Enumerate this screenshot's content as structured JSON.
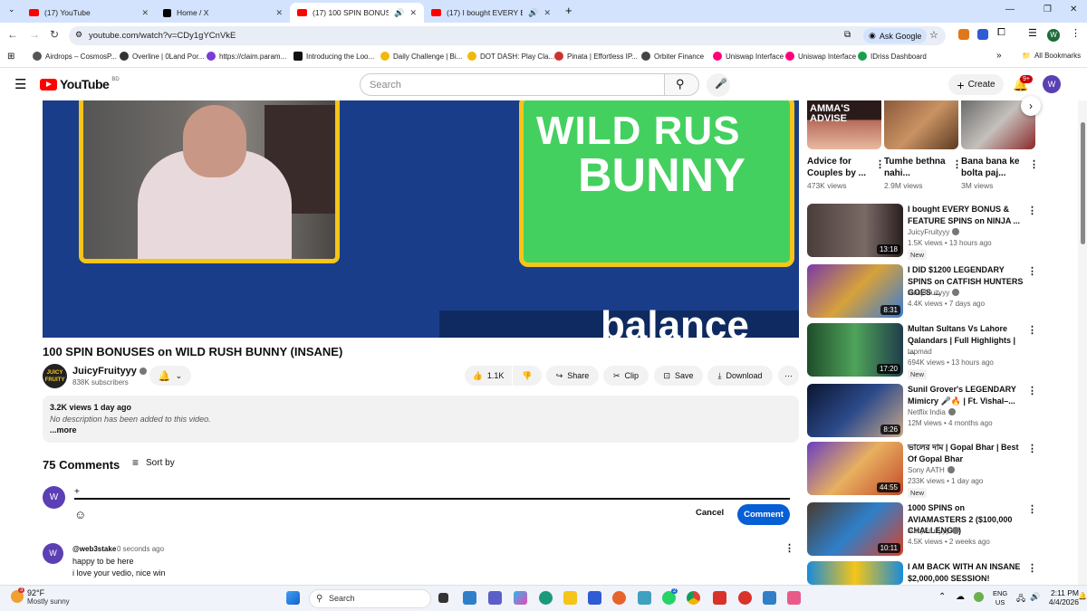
{
  "browser": {
    "tabs": [
      {
        "title": "(17) YouTube",
        "icon": "youtube-icon"
      },
      {
        "title": "Home / X",
        "icon": "x-icon"
      },
      {
        "title": "(17) 100 SPIN BONUSES on",
        "icon": "youtube-icon",
        "active": true
      },
      {
        "title": "(17) I bought EVERY BONUS",
        "icon": "youtube-icon"
      }
    ],
    "url": "youtube.com/watch?v=CDy1gYCnVkE",
    "ask_google": "Ask Google",
    "profile_initial": "W",
    "bookmarks": [
      "Airdrops – CosmosP...",
      "Overline | 0Land Por...",
      "https://claim.param...",
      "Introducing the Loo...",
      "Daily Challenge | Bi...",
      "DOT DASH: Play Cla...",
      "Pinata | Effortless IP...",
      "Orbiter Finance",
      "Uniswap Interface",
      "Uniswap Interface",
      "IDriss Dashboard"
    ],
    "all_bookmarks": "All Bookmarks"
  },
  "youtube": {
    "logo_text": "YouTube",
    "country": "BD",
    "search_placeholder": "Search",
    "create_label": "Create",
    "notif_count": "9+",
    "avatar_initial": "W"
  },
  "video": {
    "overlay_text_1": "WILD RUS",
    "overlay_text_2": "BUNNY",
    "overlay_text_3": "balance",
    "title": "100 SPIN BONUSES on WILD RUSH BUNNY (INSANE)",
    "channel": "JuicyFruityyy",
    "channel_logo_text": "JUICY FRUITY",
    "subscribers": "838K subscribers",
    "likes": "1.1K",
    "share": "Share",
    "clip": "Clip",
    "save": "Save",
    "download": "Download",
    "views_date": "3.2K views  1 day ago",
    "description": "No description has been added to this video.",
    "more": "...more"
  },
  "comments": {
    "count_label": "75 Comments",
    "sort_by": "Sort by",
    "input_value": "+",
    "cancel": "Cancel",
    "comment_btn": "Comment",
    "items": [
      {
        "user": "@web3stake",
        "time": "0 seconds ago",
        "line1": "happy to be here",
        "line2": "i love your vedio, nice win",
        "avatar": "W"
      }
    ]
  },
  "shorts": [
    {
      "title": "Advice for Couples by ...",
      "views": "473K views",
      "thumb_text": "AMMA'S ADVISE"
    },
    {
      "title": "Tumhe bethna nahi...",
      "views": "2.9M views"
    },
    {
      "title": "Bana bana ke bolta paj...",
      "views": "3M views"
    }
  ],
  "recommendations": [
    {
      "title": "I bought EVERY BONUS & FEATURE SPINS on NINJA ...",
      "channel": "JuicyFruityyy",
      "verified": true,
      "meta": "1.5K views • 13 hours ago",
      "badge": "New",
      "duration": "13:18",
      "color": "#5a4a46"
    },
    {
      "title": "I DID $1200 LEGENDARY SPINS on CATFISH HUNTERS GOES ...",
      "channel": "JuicyFruityyy",
      "verified": true,
      "meta": "4.4K views • 7 days ago",
      "badge": "",
      "duration": "8:31",
      "color": "#8b3fa8"
    },
    {
      "title": "Multan Sultans Vs Lahore Qalandars | Full Highlights | ...",
      "channel": "tapmad",
      "verified": false,
      "meta": "694K views • 13 hours ago",
      "badge": "New",
      "duration": "17:20",
      "color": "#2e6b3a"
    },
    {
      "title": "Sunil Grover's LEGENDARY Mimicry 🎤🔥 | Ft. Vishal–...",
      "channel": "Netflix India",
      "verified": true,
      "meta": "12M views • 4 months ago",
      "badge": "",
      "duration": "8:26",
      "color": "#1d2a4a"
    },
    {
      "title": "ভালের দাম | Gopal Bhar | Best Of Gopal Bhar",
      "channel": "Sony AATH",
      "verified": true,
      "meta": "233K views • 1 day ago",
      "badge": "New",
      "duration": "44:55",
      "color": "#7a4bc4"
    },
    {
      "title": "1000 SPINS on AVIAMASTERS 2 ($100,000 CHALLENGE)",
      "channel": "JuicyFruityyy",
      "verified": true,
      "meta": "4.5K views • 2 weeks ago",
      "badge": "",
      "duration": "10:11",
      "color": "#2f7fc9"
    },
    {
      "title": "I AM BACK WITH AN INSANE $2,000,000 SESSION! @AyeZe...",
      "channel": "",
      "verified": false,
      "meta": "",
      "badge": "",
      "duration": "",
      "color": "#1a8bd9"
    }
  ],
  "taskbar": {
    "temp": "92°F",
    "condition": "Mostly sunny",
    "weather_badge": "3",
    "search": "Search",
    "lang1": "ENG",
    "lang2": "US",
    "time": "2:11 PM",
    "date": "4/4/2026",
    "chat_badge": "2"
  }
}
